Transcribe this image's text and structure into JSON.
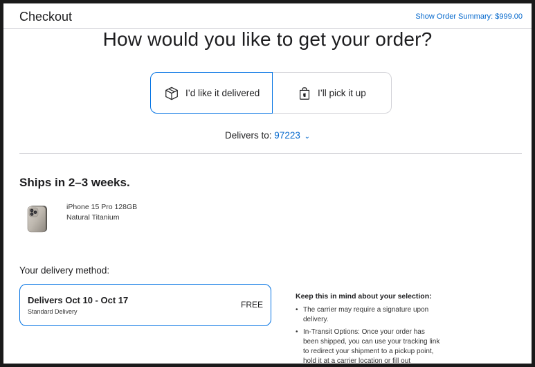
{
  "header": {
    "title": "Checkout",
    "order_summary_link": "Show Order Summary: $999.00"
  },
  "heading": "How would you like to get your order?",
  "fulfillment_options": [
    {
      "label": "I’d like it delivered",
      "icon": "package-box-icon",
      "selected": true
    },
    {
      "label": "I’ll pick it up",
      "icon": "apple-bag-icon",
      "selected": false
    }
  ],
  "delivers_to": {
    "label": "Delivers to:",
    "zip": "97223",
    "chevron": "⌄"
  },
  "shipping": {
    "ships_in": "Ships in 2–3 weeks."
  },
  "product": {
    "name": "iPhone 15 Pro 128GB",
    "color": "Natural Titanium",
    "image": "iphone-15-pro-image"
  },
  "delivery_method": {
    "label": "Your delivery method:",
    "option": {
      "title": "Delivers Oct 10 - Oct 17",
      "subtitle": "Standard Delivery",
      "price": "FREE",
      "selected": true
    }
  },
  "note": {
    "title": "Keep this in mind about your selection:",
    "items": [
      "The carrier may require a signature upon delivery.",
      "In-Transit Options: Once your order has been shipped, you can use your tracking link to redirect your shipment to a pickup point, hold it at a carrier location or fill out"
    ]
  },
  "colors": {
    "link": "#0066cc",
    "selected_border": "#0071e3",
    "text": "#1d1d1f",
    "divider": "#d2d2d7"
  }
}
